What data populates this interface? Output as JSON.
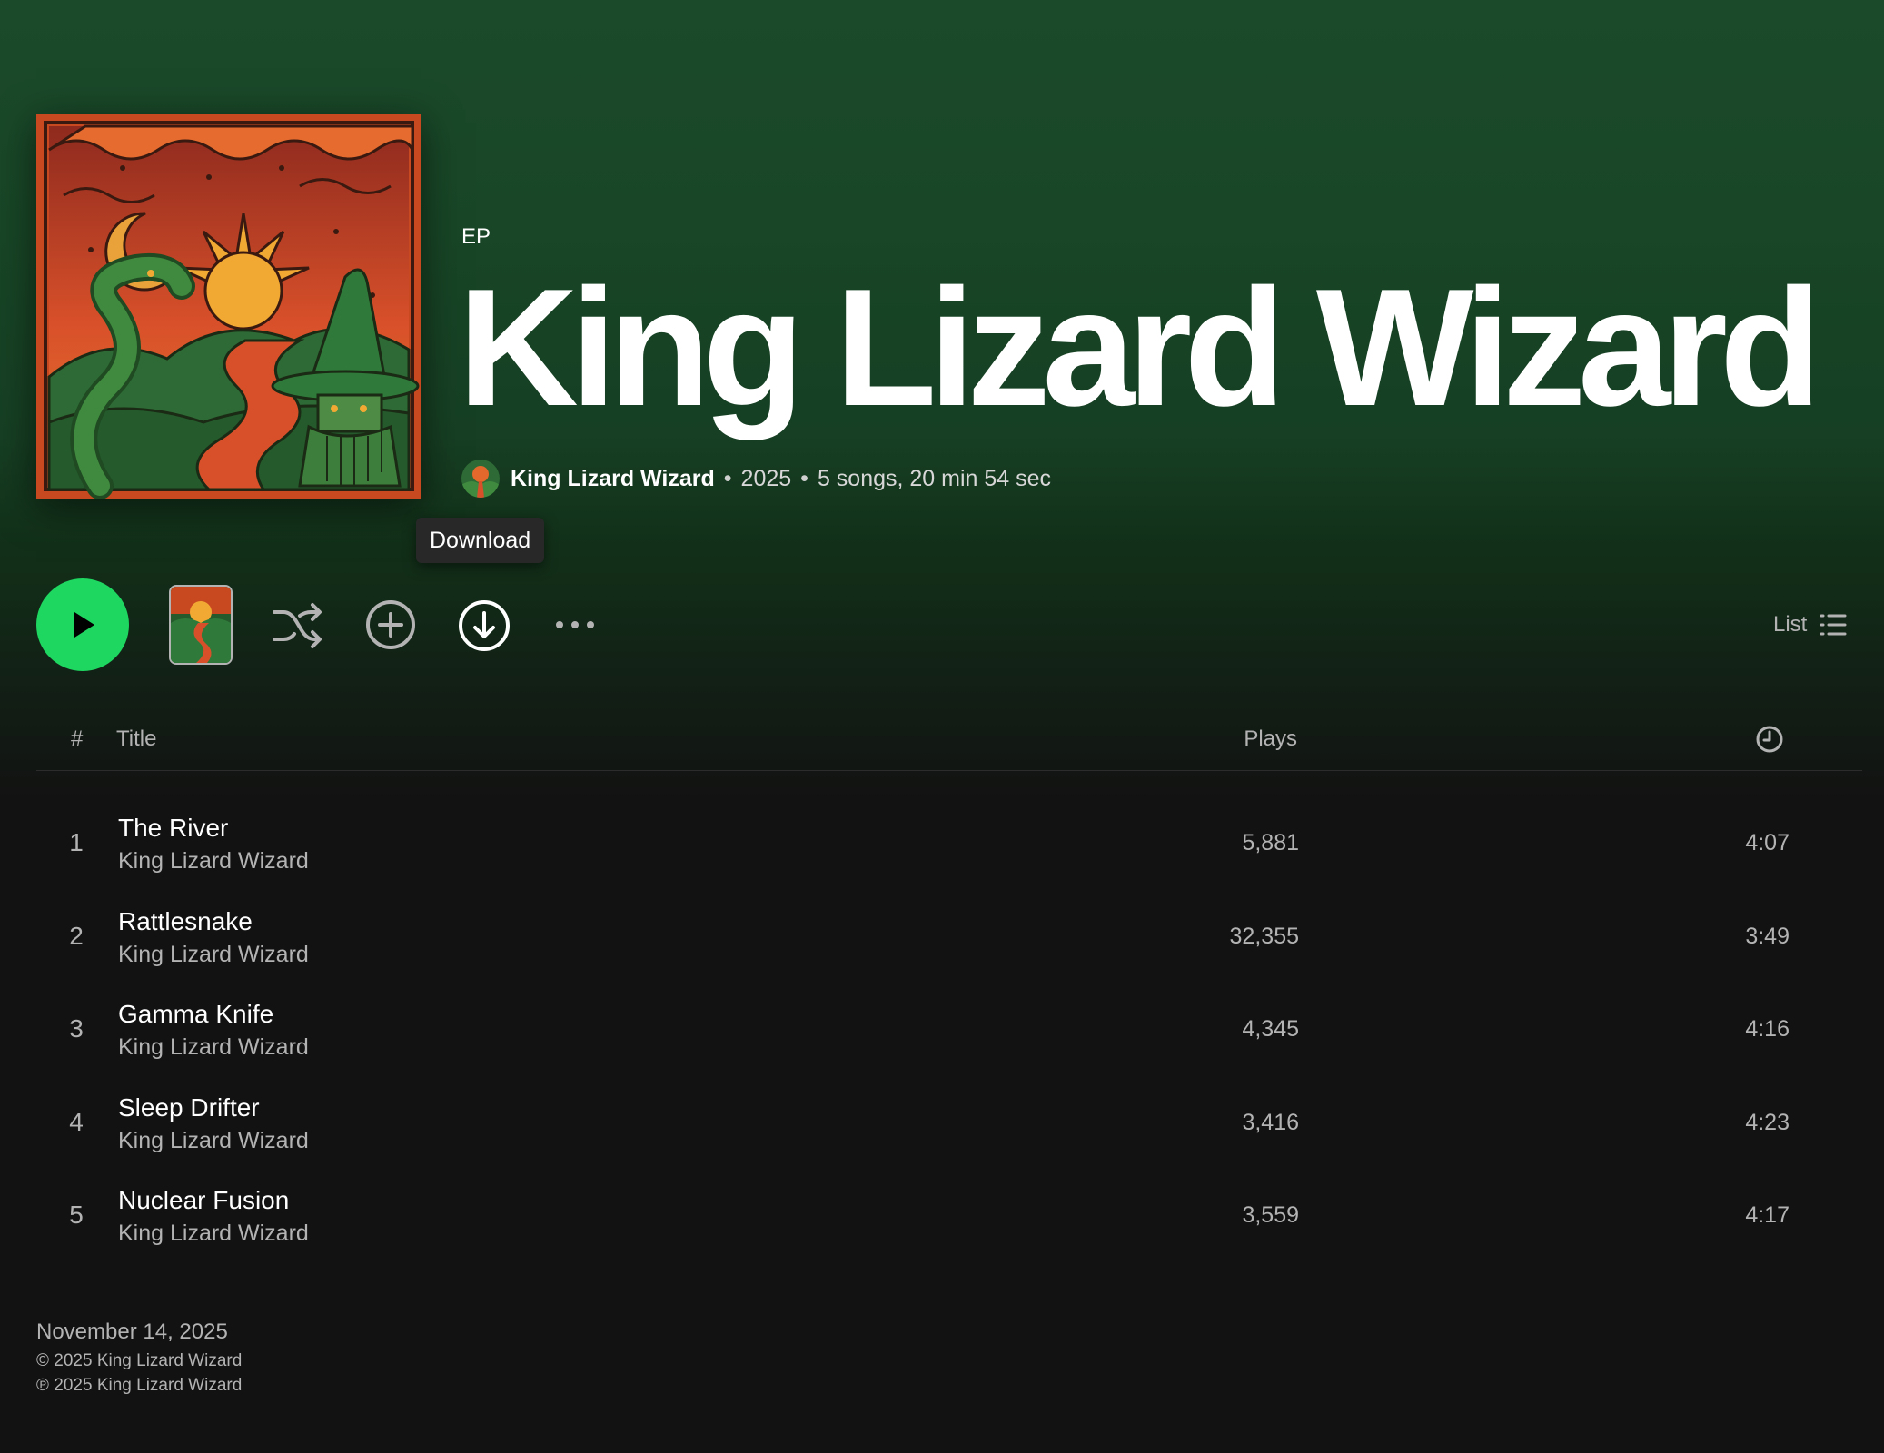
{
  "album": {
    "type": "EP",
    "title": "King Lizard Wizard",
    "artist": "King Lizard Wizard",
    "year": "2025",
    "summary": "5 songs, 20 min 54 sec",
    "separator": "•"
  },
  "tooltip": {
    "text": "Download"
  },
  "actions": {
    "play": "play-icon",
    "shuffle": "shuffle-icon",
    "add": "add-circle-icon",
    "download": "download-icon",
    "more": "more-icon",
    "view_label": "List",
    "view_icon": "list-icon"
  },
  "table": {
    "headers": {
      "num": "#",
      "title": "Title",
      "plays": "Plays",
      "duration_icon": "clock-icon"
    },
    "tracks": [
      {
        "num": "1",
        "title": "The River",
        "artist": "King Lizard Wizard",
        "plays": "5,881",
        "duration": "4:07"
      },
      {
        "num": "2",
        "title": "Rattlesnake",
        "artist": "King Lizard Wizard",
        "plays": "32,355",
        "duration": "3:49"
      },
      {
        "num": "3",
        "title": "Gamma Knife",
        "artist": "King Lizard Wizard",
        "plays": "4,345",
        "duration": "4:16"
      },
      {
        "num": "4",
        "title": "Sleep Drifter",
        "artist": "King Lizard Wizard",
        "plays": "3,416",
        "duration": "4:23"
      },
      {
        "num": "5",
        "title": "Nuclear Fusion",
        "artist": "King Lizard Wizard",
        "plays": "3,559",
        "duration": "4:17"
      }
    ]
  },
  "footer": {
    "release_date": "November 14, 2025",
    "copyright": "© 2025 King Lizard Wizard",
    "phonographic": "℗ 2025 King Lizard Wizard"
  },
  "colors": {
    "accent": "#1ed760",
    "background": "#121212",
    "header_green": "#1b4a2a",
    "muted_text": "#b3b3b3"
  }
}
